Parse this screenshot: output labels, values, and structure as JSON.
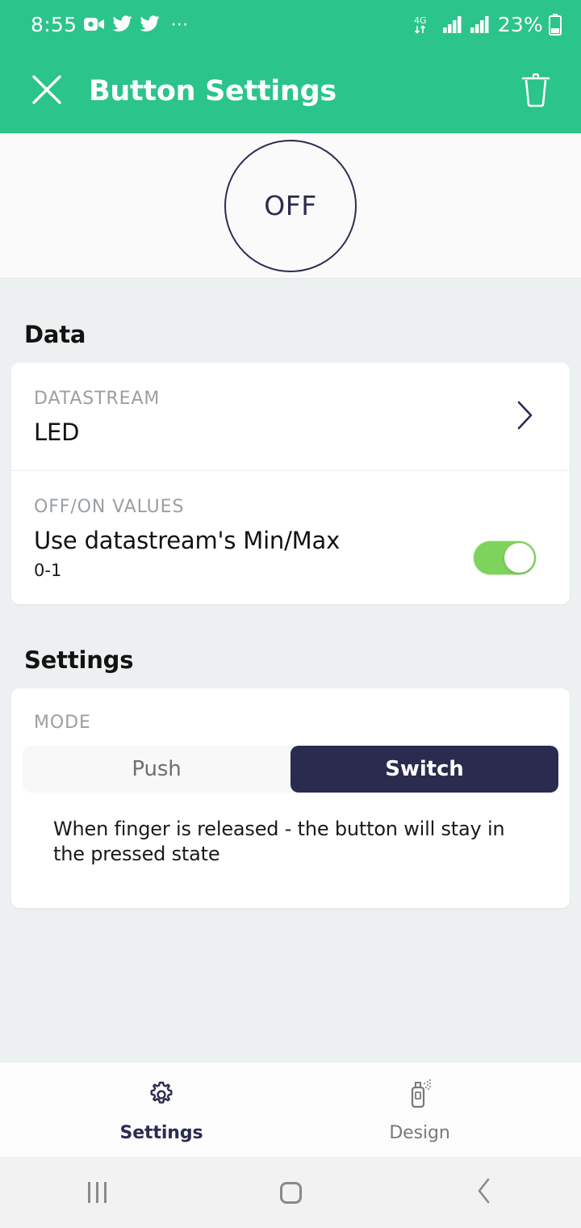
{
  "theme": {
    "accent_green": "#2BC48A",
    "toggle_green": "#7ED35C",
    "navy": "#2C2C4F",
    "body_bg": "#ECF0F0",
    "card_bg": "#FFFFFF",
    "label_gray": "#9A9FA3"
  },
  "status_bar": {
    "time": "8:55",
    "icons": [
      "video-camera-icon",
      "twitter-icon",
      "twitter-icon",
      "more-dots-icon"
    ],
    "network_type": "4G",
    "network_arrows": "↓↑",
    "signal_icons": [
      "signal-bars-icon",
      "signal-bars-icon"
    ],
    "battery_percent": "23%",
    "battery_icon": "battery-icon"
  },
  "app_bar": {
    "close_icon": "close-icon",
    "title": "Button Settings",
    "delete_icon": "trash-icon"
  },
  "widget_preview": {
    "button_state_label": "OFF"
  },
  "sections": [
    {
      "heading": "Data",
      "rows": [
        {
          "label": "DATASTREAM",
          "value": "LED",
          "accessory": "chevron-right-icon"
        },
        {
          "label": "OFF/ON VALUES",
          "value": "Use datastream's Min/Max",
          "sub": "0-1",
          "accessory": "toggle-switch",
          "toggle_on": true
        }
      ]
    },
    {
      "heading": "Settings",
      "mode": {
        "label": "MODE",
        "options": [
          "Push",
          "Switch"
        ],
        "selected": "Switch",
        "description": "When finger is released - the button will stay in the pressed state"
      }
    }
  ],
  "tab_bar": {
    "tabs": [
      {
        "label": "Settings",
        "icon": "gear-icon",
        "active": true
      },
      {
        "label": "Design",
        "icon": "spray-can-icon",
        "active": false
      }
    ]
  },
  "nav_bar": {
    "recents_icon": "recents-icon",
    "home_icon": "home-icon",
    "back_icon": "back-chevron-icon"
  }
}
